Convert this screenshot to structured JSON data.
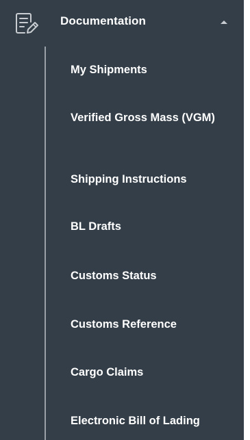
{
  "section": {
    "label": "Documentation",
    "icon": "document-edit-icon",
    "expand_icon": "caret-up-icon",
    "expanded": true
  },
  "menu": {
    "items": [
      {
        "label": "My Shipments"
      },
      {
        "label": "Verified Gross Mass (VGM)"
      },
      {
        "label": "Shipping Instructions"
      },
      {
        "label": "BL Drafts"
      },
      {
        "label": "Customs Status"
      },
      {
        "label": "Customs Reference"
      },
      {
        "label": "Cargo Claims"
      },
      {
        "label": "Electronic Bill of Lading"
      }
    ]
  },
  "colors": {
    "background": "#333e48",
    "text": "#ffffff",
    "tree_line": "#9aa1a8",
    "icon": "#c9cdd1"
  }
}
